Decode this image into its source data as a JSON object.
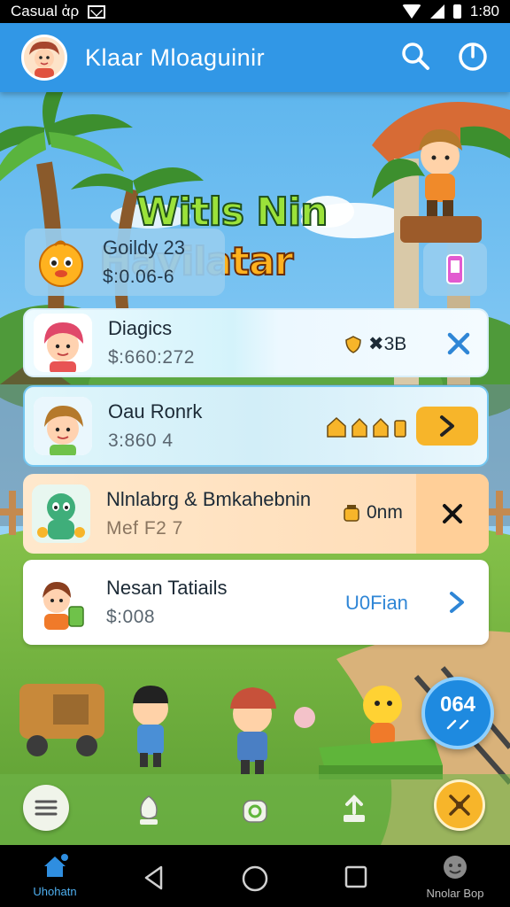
{
  "status_bar": {
    "carrier_text": "Casual ἀρ",
    "time": "1:80"
  },
  "app_bar": {
    "title": "Klaar Mloaguinir",
    "actions": [
      "search-icon",
      "power-icon"
    ]
  },
  "hero": {
    "line1": "Witls Nin",
    "line2": "Havilatar"
  },
  "cards": [
    {
      "name": "Goildy 23",
      "sub": "$:0.06-6",
      "meta": "",
      "action": ""
    },
    {
      "name": "Diagics",
      "sub": "$:660:272",
      "meta": "✖3B",
      "action": "close"
    },
    {
      "name": "Oau Ronrk",
      "sub": "3:860 4",
      "meta": "",
      "action": "next"
    },
    {
      "name": "Nlnlabrg & Bmkahebnin",
      "sub": "Mef F2 7",
      "meta": "0nm",
      "action": "close"
    },
    {
      "name": "Nesan Tatiails",
      "sub": "$:008",
      "meta": "U0Fian",
      "action": "next"
    }
  ],
  "floating_badge": {
    "value": "064"
  },
  "nav": {
    "home_label": "Uhohatn",
    "games_label": "Nnolar Bop"
  },
  "colors": {
    "primary": "#3197e6",
    "accent": "#f7b52a",
    "x_blue": "#2f86d6"
  }
}
